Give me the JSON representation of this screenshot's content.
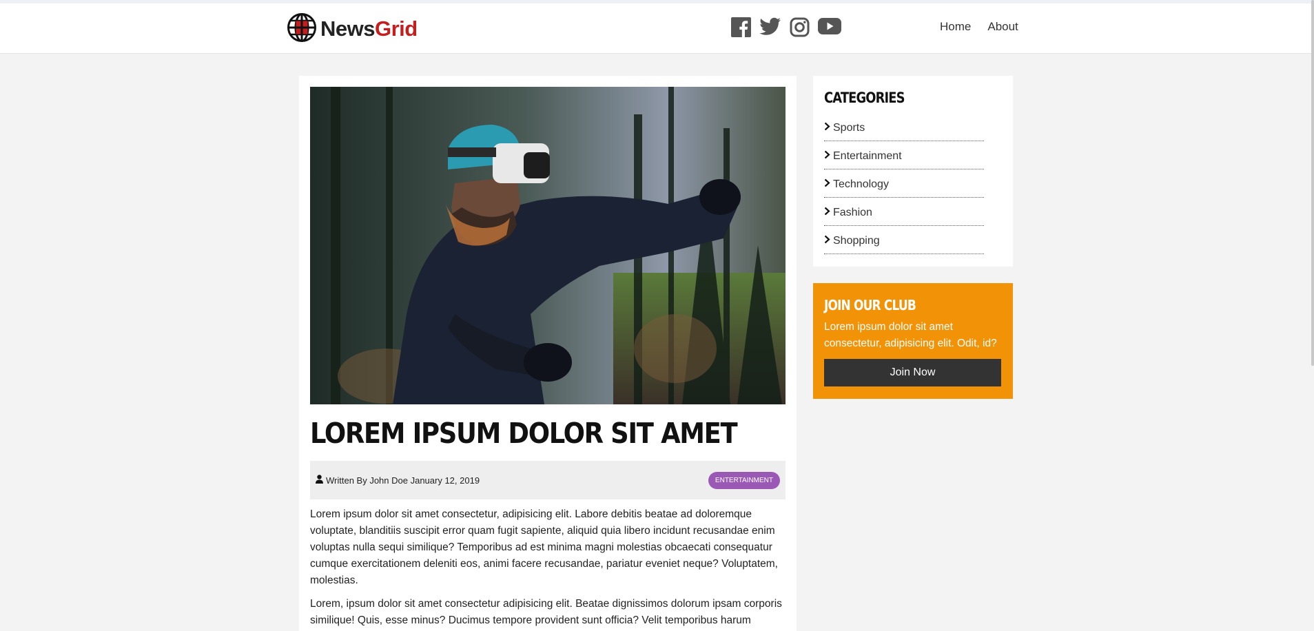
{
  "site": {
    "logo_primary": "News",
    "logo_accent": "Grid"
  },
  "social": [
    "facebook-icon",
    "twitter-icon",
    "instagram-icon",
    "youtube-icon"
  ],
  "nav": {
    "home": "Home",
    "about": "About"
  },
  "article": {
    "title": "Lorem Ipsum Dolor Sit Amet",
    "byline": "Written By John Doe January 12, 2019",
    "category_badge": "Entertainment",
    "paragraph_1": "Lorem ipsum dolor sit amet consectetur, adipisicing elit. Labore debitis beatae ad doloremque voluptate, blanditiis suscipit error quam fugit sapiente, aliquid quia libero incidunt recusandae enim voluptas nulla sequi similique? Temporibus ad est minima magni molestias obcaecati consequatur cumque exercitationem deleniti eos, animi facere recusandae, pariatur eveniet neque? Voluptatem, molestias.",
    "paragraph_2": "Lorem, ipsum dolor sit amet consectetur adipisicing elit. Beatae dignissimos dolorum ipsam corporis similique! Quis, esse minus? Ducimus tempore provident sunt officia? Velit temporibus harum voluptate, ipsum quisquam rerum doloremque consectetur quae incidunt deleniti dicta, excepturi"
  },
  "categories": {
    "heading": "Categories",
    "items": [
      "Sports",
      "Entertainment",
      "Technology",
      "Fashion",
      "Shopping"
    ]
  },
  "club": {
    "heading": "Join Our Club",
    "text": "Lorem ipsum dolor sit amet consectetur, adipisicing elit. Odit, id?",
    "button": "Join Now"
  },
  "colors": {
    "brand_red": "#c41e1e",
    "club_orange": "#f29207",
    "badge_purple": "#9b59b6",
    "dark": "#333333"
  }
}
